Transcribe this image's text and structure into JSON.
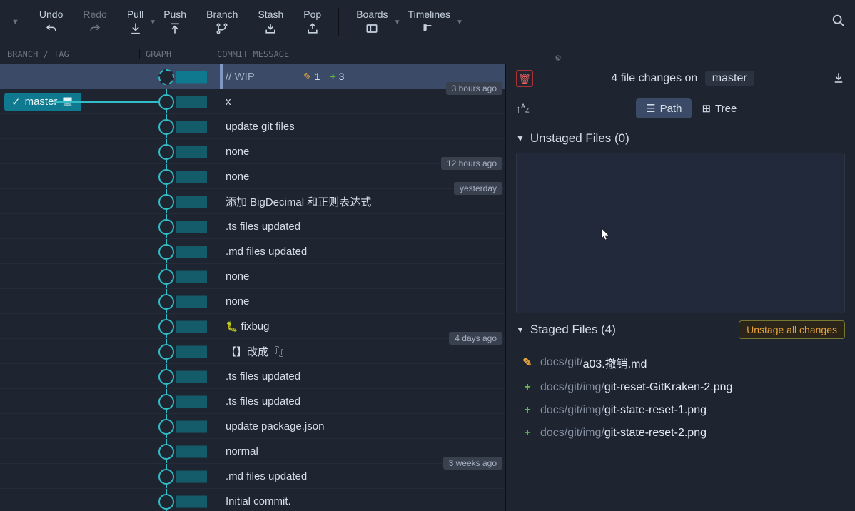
{
  "toolbar": {
    "undo": "Undo",
    "redo": "Redo",
    "pull": "Pull",
    "push": "Push",
    "branch": "Branch",
    "stash": "Stash",
    "pop": "Pop",
    "boards": "Boards",
    "timelines": "Timelines"
  },
  "columns": {
    "branch": "BRANCH / TAG",
    "graph": "GRAPH",
    "msg": "COMMIT MESSAGE"
  },
  "branch_pill": {
    "name": "master"
  },
  "wip": {
    "label": "// WIP",
    "mod_count": "1",
    "add_count": "3"
  },
  "commits": [
    {
      "msg": "x",
      "time": "3 hours ago"
    },
    {
      "msg": "update git files"
    },
    {
      "msg": "none"
    },
    {
      "msg": "none",
      "time": "12 hours ago"
    },
    {
      "msg": "添加 BigDecimal 和正则表达式",
      "time": "yesterday"
    },
    {
      "msg": ".ts files updated"
    },
    {
      "msg": ".md files updated"
    },
    {
      "msg": "none"
    },
    {
      "msg": "none"
    },
    {
      "msg": "fixbug",
      "bug": true
    },
    {
      "msg": "【】改成『』",
      "time": "4 days ago"
    },
    {
      "msg": ".ts files updated"
    },
    {
      "msg": ".ts files updated"
    },
    {
      "msg": "update package.json"
    },
    {
      "msg": "normal"
    },
    {
      "msg": ".md files updated",
      "time": "3 weeks ago"
    },
    {
      "msg": "Initial commit."
    }
  ],
  "panel": {
    "changes_prefix": "4 file changes on",
    "branch": "master",
    "path_tab": "Path",
    "tree_tab": "Tree",
    "unstaged_title": "Unstaged Files (0)",
    "staged_title": "Staged Files (4)",
    "unstage_btn": "Unstage all changes",
    "files": [
      {
        "type": "mod",
        "dim": "docs/git/",
        "name": "a03.撤销.md"
      },
      {
        "type": "add",
        "dim": "docs/git/img/",
        "name": "git-reset-GitKraken-2.png"
      },
      {
        "type": "add",
        "dim": "docs/git/img/",
        "name": "git-state-reset-1.png"
      },
      {
        "type": "add",
        "dim": "docs/git/img/",
        "name": "git-state-reset-2.png"
      }
    ]
  }
}
